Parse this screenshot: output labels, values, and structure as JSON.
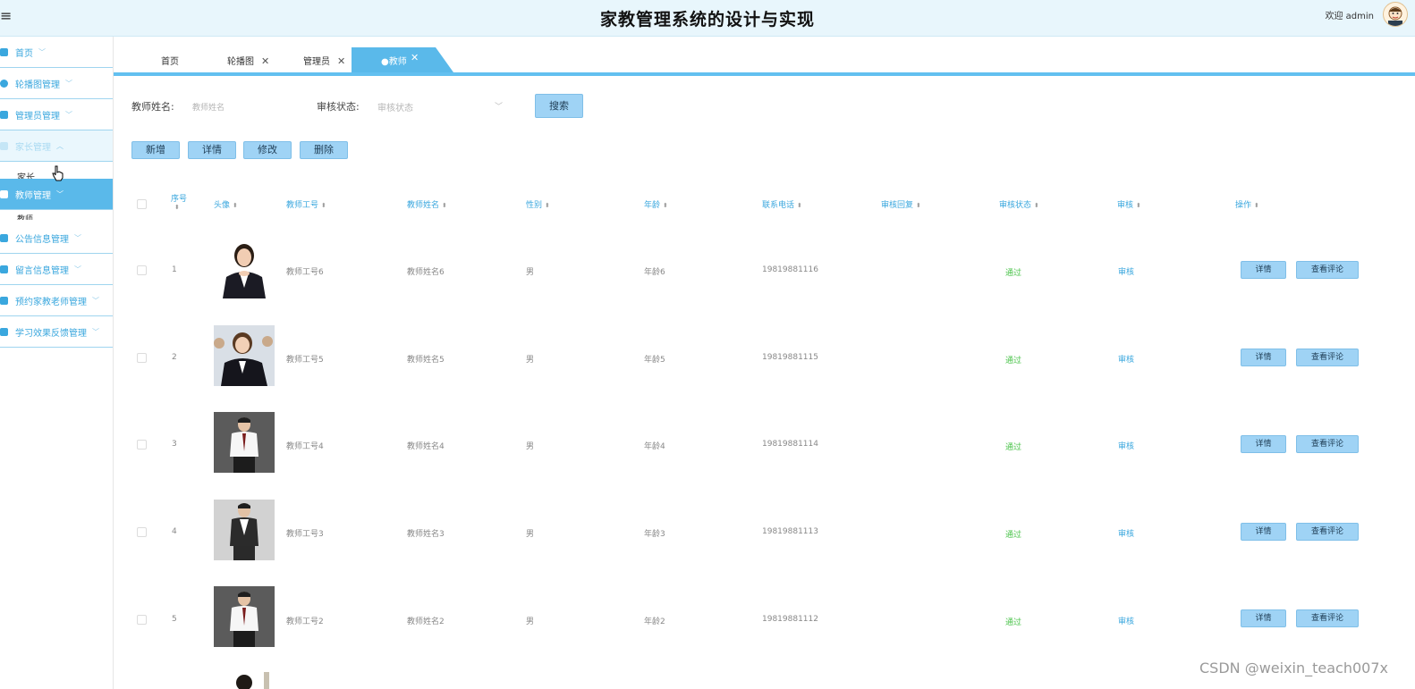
{
  "header": {
    "title": "家教管理系统的设计与实现",
    "welcome": "欢迎 admin",
    "menu_icon": "≡"
  },
  "sidebar": {
    "items": [
      {
        "label": "首页",
        "icon": "home-icon"
      },
      {
        "label": "轮播图管理",
        "icon": "carousel-icon"
      },
      {
        "label": "管理员管理",
        "icon": "admin-icon"
      },
      {
        "label": "家长管理",
        "icon": "parent-icon"
      },
      {
        "label": "教师管理",
        "icon": "teacher-icon"
      },
      {
        "label": "公告信息管理",
        "icon": "notice-icon"
      },
      {
        "label": "留言信息管理",
        "icon": "message-icon"
      },
      {
        "label": "预约家教老师管理",
        "icon": "appointment-icon"
      },
      {
        "label": "学习效果反馈管理",
        "icon": "feedback-icon"
      }
    ],
    "submenu_parent": "家长",
    "submenu_teacher": "教师"
  },
  "tabs": [
    {
      "label": "首页"
    },
    {
      "label": "轮播图"
    },
    {
      "label": "管理员"
    },
    {
      "label": "●教师"
    }
  ],
  "search": {
    "name_label": "教师姓名:",
    "name_placeholder": "教师姓名",
    "status_label": "审核状态:",
    "status_placeholder": "审核状态",
    "search_button": "搜索"
  },
  "toolbar": {
    "add": "新增",
    "detail": "详情",
    "edit": "修改",
    "delete": "删除"
  },
  "table": {
    "headers": [
      "序号",
      "头像",
      "教师工号",
      "教师姓名",
      "性别",
      "年龄",
      "联系电话",
      "审核回复",
      "审核状态",
      "审核",
      "操作"
    ],
    "rows": [
      {
        "index": "1",
        "worker_id": "教师工号6",
        "name": "教师姓名6",
        "gender": "男",
        "age": "年龄6",
        "phone": "19819881116",
        "status": "通过",
        "audit": "审核"
      },
      {
        "index": "2",
        "worker_id": "教师工号5",
        "name": "教师姓名5",
        "gender": "男",
        "age": "年龄5",
        "phone": "19819881115",
        "status": "通过",
        "audit": "审核"
      },
      {
        "index": "3",
        "worker_id": "教师工号4",
        "name": "教师姓名4",
        "gender": "男",
        "age": "年龄4",
        "phone": "19819881114",
        "status": "通过",
        "audit": "审核"
      },
      {
        "index": "4",
        "worker_id": "教师工号3",
        "name": "教师姓名3",
        "gender": "男",
        "age": "年龄3",
        "phone": "19819881113",
        "status": "通过",
        "audit": "审核"
      },
      {
        "index": "5",
        "worker_id": "教师工号2",
        "name": "教师姓名2",
        "gender": "男",
        "age": "年龄2",
        "phone": "19819881112",
        "status": "通过",
        "audit": "审核"
      }
    ],
    "row_detail_button": "详情",
    "row_comment_button": "查看评论"
  },
  "watermark": "CSDN @weixin_teach007x",
  "colors": {
    "accent": "#5ab9ea",
    "link": "#3aa7de",
    "pass": "#4ac34a",
    "button": "#9fd3f5"
  }
}
